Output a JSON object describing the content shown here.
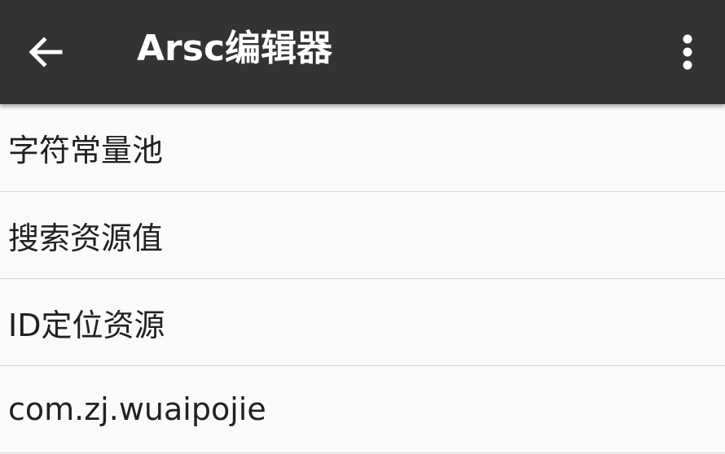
{
  "toolbar": {
    "title": "Arsc编辑器",
    "back_icon": "arrow-left-icon",
    "overflow_icon": "more-vertical-icon",
    "background_color": "#333333"
  },
  "list": {
    "items": [
      {
        "label": "字符常量池"
      },
      {
        "label": "搜索资源值"
      },
      {
        "label": "ID定位资源"
      },
      {
        "label": "com.zj.wuaipojie"
      }
    ]
  }
}
